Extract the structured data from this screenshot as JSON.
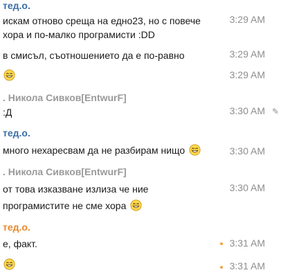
{
  "messages": [
    {
      "sender": "тед.о.",
      "lines": [
        "искам отново среща на едно23, но с повече",
        "хора и по-малко програмисти :DD"
      ],
      "time": "3:29 AM"
    },
    {
      "text": "в смисъл, съотношението да е по-равно",
      "time": "3:29 AM"
    },
    {
      "emoji": "smiley",
      "time": "3:29 AM"
    },
    {
      "sender": ". Никола Сивков[EntwurF]",
      "text": ":Д",
      "time": "3:30 AM"
    },
    {
      "sender": "тед.о.",
      "text": "много нехаресвам да не разбирам нищо",
      "time": "3:30 AM"
    },
    {
      "sender": ". Никола Сивков[EntwurF]",
      "lines": [
        "от това изказване излиза че ние",
        "програмистите не сме хора"
      ],
      "time": "3:30 AM"
    },
    {
      "sender": "тед.о.",
      "text": "е, факт.",
      "time": "3:31 AM"
    },
    {
      "emoji": "smiley",
      "time": "3:31 AM"
    }
  ],
  "colors": {
    "sender_blue": "#3a6ea5",
    "sender_grey": "#9a9a9a",
    "sender_orange": "#e8882a",
    "dot": "#f2a43a"
  }
}
